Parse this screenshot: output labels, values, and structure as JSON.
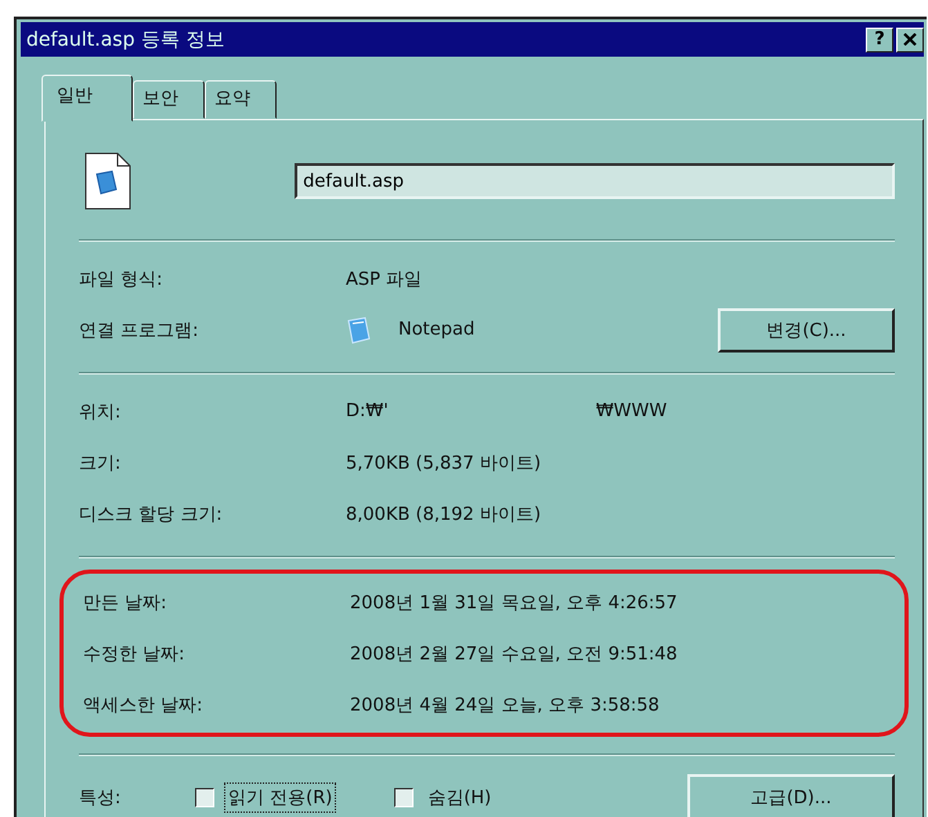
{
  "window": {
    "title": "default.asp 등록 정보",
    "help_button": "?"
  },
  "tabs": [
    {
      "label": "일반",
      "selected": true
    },
    {
      "label": "보안",
      "selected": false
    },
    {
      "label": "요약",
      "selected": false
    }
  ],
  "file_name": {
    "value": "default.asp"
  },
  "type_section": [
    {
      "label": "파일 형식:",
      "value": "ASP 파일"
    },
    {
      "label": "연결 프로그램:",
      "value": "Notepad",
      "has_app_icon": true,
      "button": "변경(C)..."
    }
  ],
  "location": {
    "label": "위치:",
    "parts": [
      "D:₩'",
      "₩WWW"
    ]
  },
  "size_section": [
    {
      "label": "크기:",
      "value": "5,70KB (5,837 바이트)"
    },
    {
      "label": "디스크 할당 크기:",
      "value": "8,00KB (8,192 바이트)"
    }
  ],
  "date_section": {
    "highlighted": true,
    "rows": [
      {
        "label": "만든 날짜:",
        "value": "2008년 1월 31일 목요일, 오후 4:26:57"
      },
      {
        "label": "수정한 날짜:",
        "value": "2008년 2월 27일 수요일, 오전 9:51:48"
      },
      {
        "label": "액세스한 날짜:",
        "value": "2008년 4월 24일 오늘, 오후 3:58:58"
      }
    ]
  },
  "attributes": {
    "label": "특성:",
    "checkboxes": [
      {
        "label": "읽기 전용(R)",
        "checked": false,
        "focused": true
      },
      {
        "label": "숨김(H)",
        "checked": false,
        "focused": false
      }
    ],
    "button": "고급(D)..."
  }
}
